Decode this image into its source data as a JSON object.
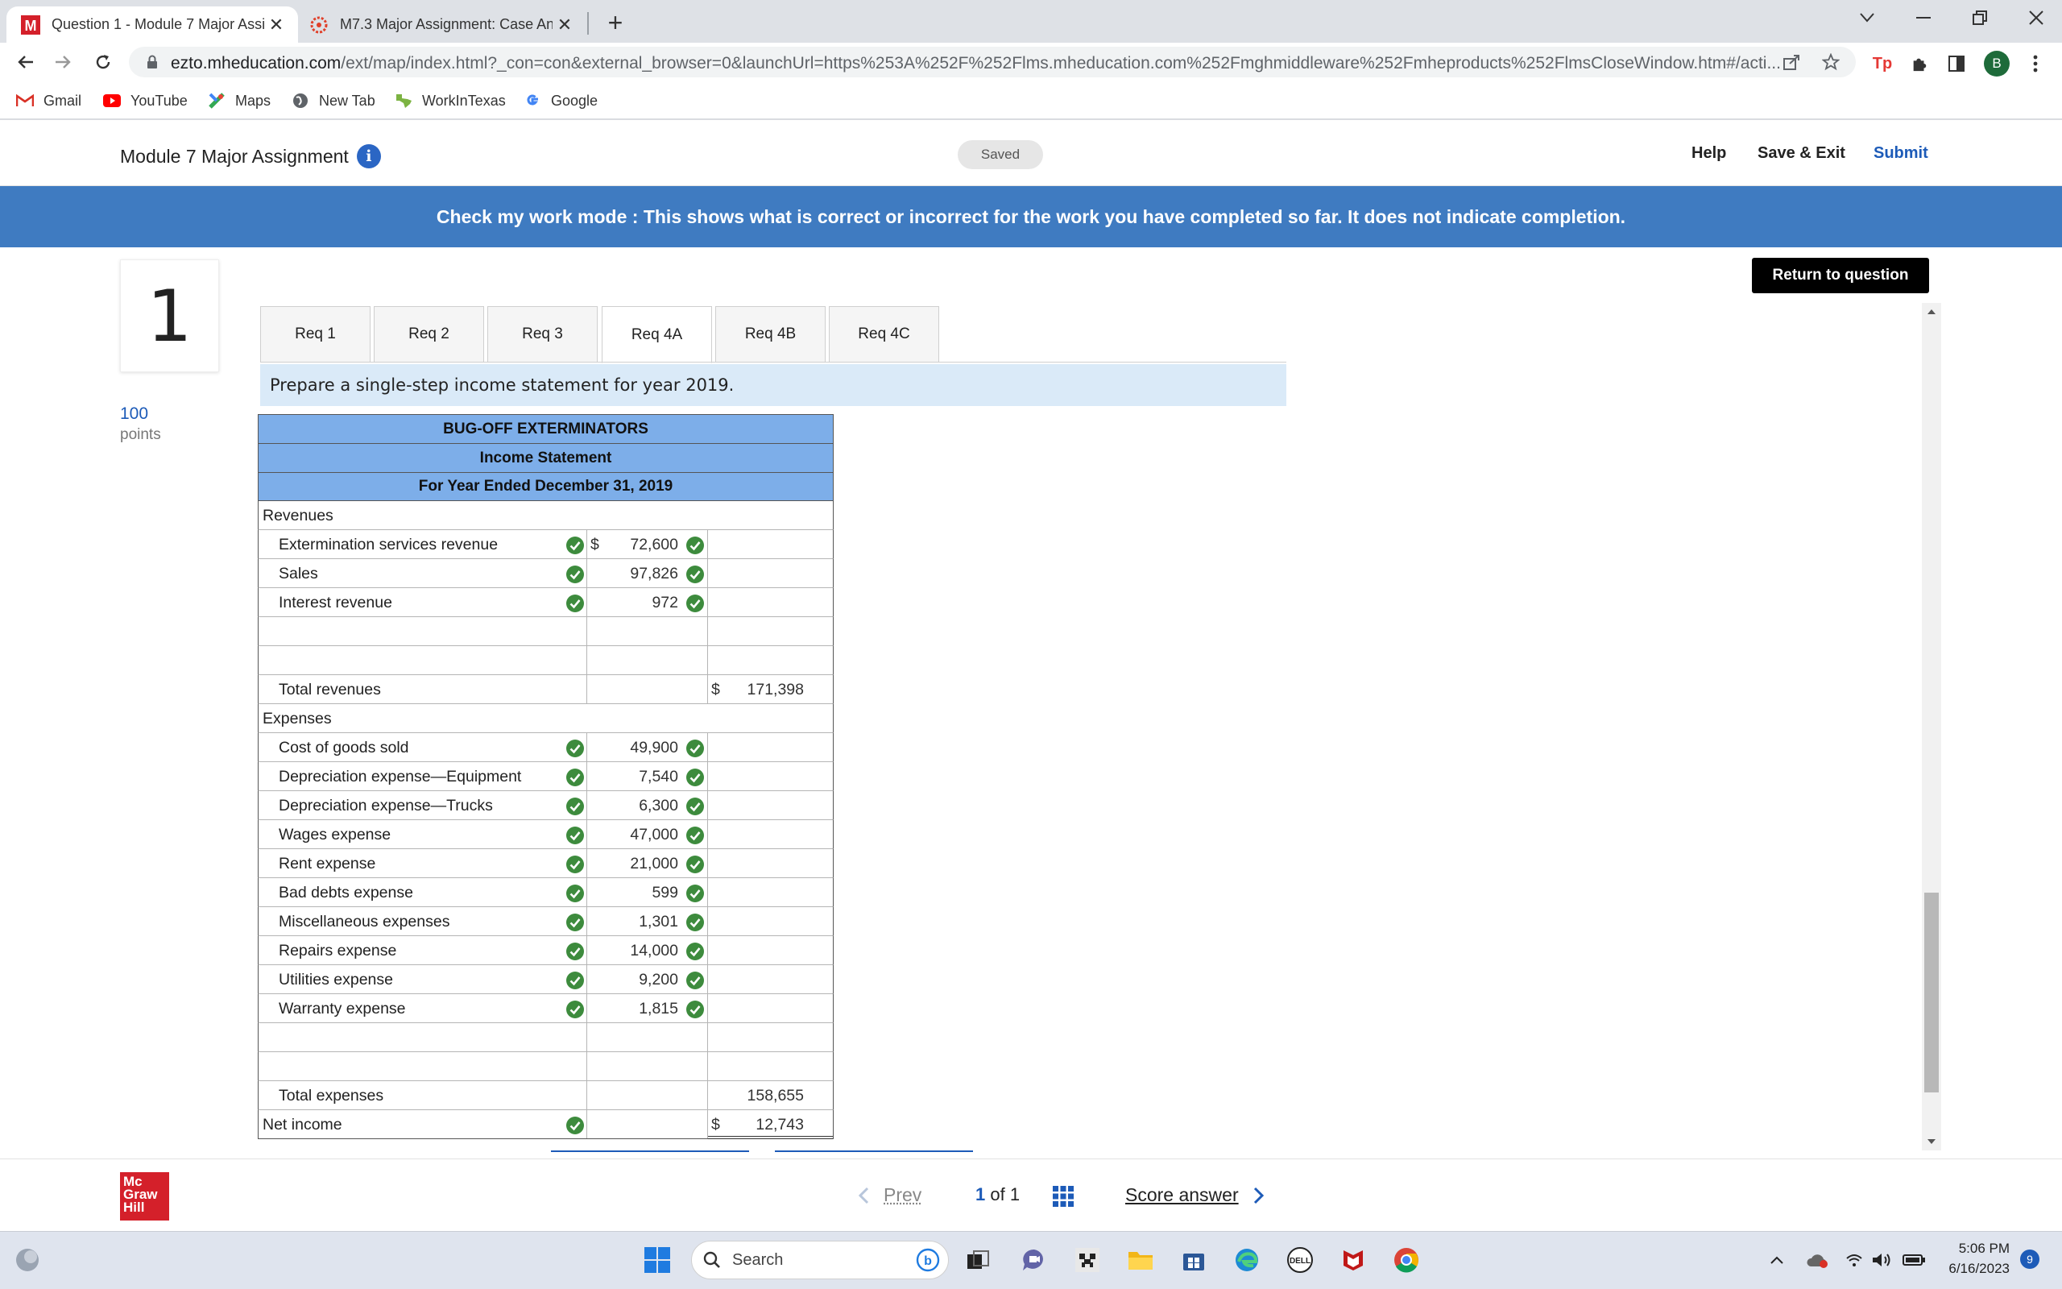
{
  "browser": {
    "tabs": [
      {
        "title": "Question 1 - Module 7 Major Assi",
        "active": true
      },
      {
        "title": "M7.3 Major Assignment: Case An",
        "active": false
      }
    ],
    "url_main": "ezto.mheducation.com",
    "url_rest": "/ext/map/index.html?_con=con&external_browser=0&launchUrl=https%253A%252F%252Flms.mheducation.com%252Fmghmiddleware%252Fmheproducts%252FlmsCloseWindow.htm#/acti...",
    "profile_initial": "B",
    "bookmarks": [
      "Gmail",
      "YouTube",
      "Maps",
      "New Tab",
      "WorkInTexas",
      "Google"
    ]
  },
  "header": {
    "title": "Module 7 Major Assignment",
    "saved": "Saved",
    "help": "Help",
    "save_exit": "Save & Exit",
    "submit": "Submit"
  },
  "banner": "Check my work mode : This shows what is correct or incorrect for the work you have completed so far. It does not indicate completion.",
  "question": {
    "number": "1",
    "points": "100",
    "points_label": "points"
  },
  "return_button": "Return to question",
  "req_tabs": [
    "Req 1",
    "Req 2",
    "Req 3",
    "Req 4A",
    "Req 4B",
    "Req 4C"
  ],
  "active_req_tab": "Req 4A",
  "instruction": "Prepare a single-step income statement for year 2019.",
  "statement": {
    "company": "BUG-OFF EXTERMINATORS",
    "title": "Income Statement",
    "period": "For Year Ended December 31, 2019",
    "revenues_heading": "Revenues",
    "revenues": [
      {
        "label": "Extermination services revenue",
        "dollar": "$",
        "amount": "72,600"
      },
      {
        "label": "Sales",
        "dollar": "",
        "amount": "97,826"
      },
      {
        "label": "Interest revenue",
        "dollar": "",
        "amount": "972"
      }
    ],
    "total_revenues_label": "Total revenues",
    "total_revenues_dollar": "$",
    "total_revenues": "171,398",
    "expenses_heading": "Expenses",
    "expenses": [
      {
        "label": "Cost of goods sold",
        "amount": "49,900"
      },
      {
        "label": "Depreciation expense—Equipment",
        "amount": "7,540"
      },
      {
        "label": "Depreciation expense—Trucks",
        "amount": "6,300"
      },
      {
        "label": "Wages expense",
        "amount": "47,000"
      },
      {
        "label": "Rent expense",
        "amount": "21,000"
      },
      {
        "label": "Bad debts expense",
        "amount": "599"
      },
      {
        "label": "Miscellaneous expenses",
        "amount": "1,301"
      },
      {
        "label": "Repairs expense",
        "amount": "14,000"
      },
      {
        "label": "Utilities expense",
        "amount": "9,200"
      },
      {
        "label": "Warranty expense",
        "amount": "1,815"
      }
    ],
    "total_expenses_label": "Total expenses",
    "total_expenses": "158,655",
    "net_income_label": "Net income",
    "net_income_dollar": "$",
    "net_income": "12,743"
  },
  "footer": {
    "prev": "Prev",
    "page_current": "1",
    "page_of": "of",
    "page_total": "1",
    "score_answer": "Score answer",
    "logo": "Mc Graw Hill"
  },
  "taskbar": {
    "search": "Search",
    "time": "5:06 PM",
    "date": "6/16/2023",
    "notifications": "9"
  },
  "colors": {
    "accent_blue": "#1d5bb8",
    "banner_blue": "#3f7bc1",
    "statement_header": "#7daee9",
    "check_green": "#3d8b3d",
    "mh_red": "#d4202a"
  }
}
